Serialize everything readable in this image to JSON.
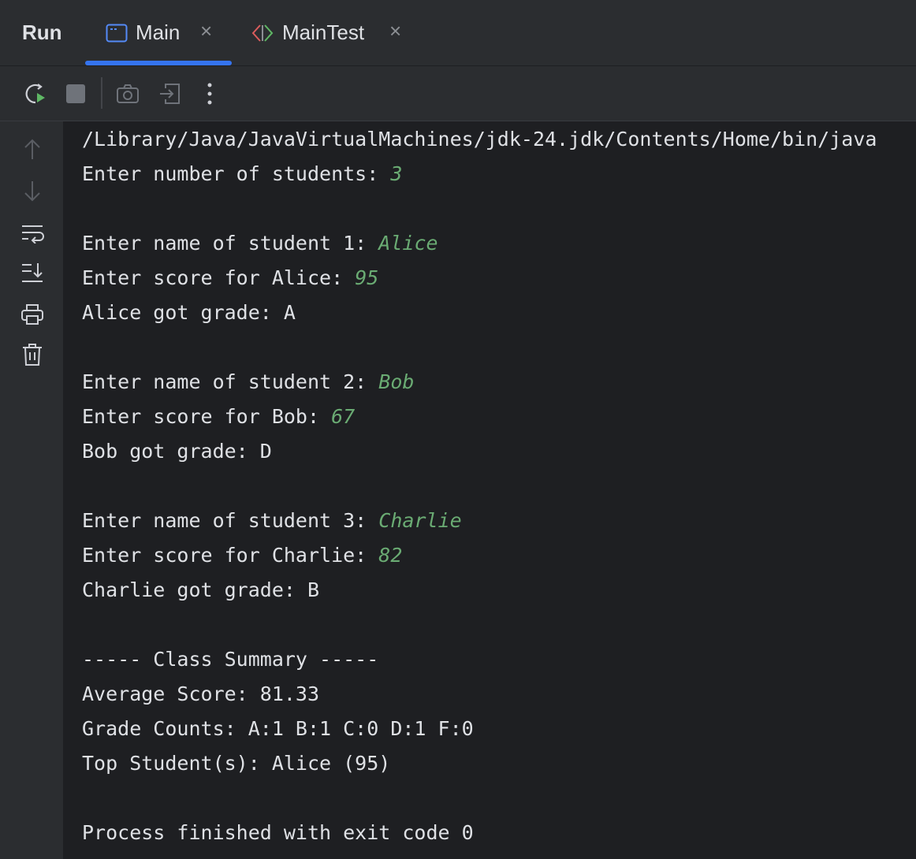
{
  "tabbar": {
    "run_label": "Run",
    "tabs": [
      {
        "label": "Main",
        "icon": "console-window-icon",
        "active": true
      },
      {
        "label": "MainTest",
        "icon": "test-diamond-icon",
        "active": false
      }
    ],
    "close_glyph": "×"
  },
  "colors": {
    "background": "#1e1f22",
    "panel": "#2b2d30",
    "text": "#dfe1e5",
    "user_input": "#6aab73",
    "accent": "#3574f0"
  },
  "toolbar": {
    "buttons": [
      "rerun-icon",
      "stop-icon",
      "screenshot-icon",
      "attach-icon",
      "more-icon"
    ]
  },
  "sidebar": {
    "buttons": [
      "arrow-up-icon",
      "arrow-down-icon",
      "soft-wrap-icon",
      "scroll-to-end-icon",
      "print-icon",
      "trash-icon"
    ]
  },
  "console": {
    "lines": [
      {
        "text": "/Library/Java/JavaVirtualMachines/jdk-24.jdk/Contents/Home/bin/java",
        "input": ""
      },
      {
        "text": "Enter number of students: ",
        "input": "3"
      },
      {
        "text": "",
        "input": ""
      },
      {
        "text": "Enter name of student 1: ",
        "input": "Alice"
      },
      {
        "text": "Enter score for Alice: ",
        "input": "95"
      },
      {
        "text": "Alice got grade: A",
        "input": ""
      },
      {
        "text": "",
        "input": ""
      },
      {
        "text": "Enter name of student 2: ",
        "input": "Bob"
      },
      {
        "text": "Enter score for Bob: ",
        "input": "67"
      },
      {
        "text": "Bob got grade: D",
        "input": ""
      },
      {
        "text": "",
        "input": ""
      },
      {
        "text": "Enter name of student 3: ",
        "input": "Charlie"
      },
      {
        "text": "Enter score for Charlie: ",
        "input": "82"
      },
      {
        "text": "Charlie got grade: B",
        "input": ""
      },
      {
        "text": "",
        "input": ""
      },
      {
        "text": "----- Class Summary -----",
        "input": ""
      },
      {
        "text": "Average Score: 81.33",
        "input": ""
      },
      {
        "text": "Grade Counts: A:1 B:1 C:0 D:1 F:0",
        "input": ""
      },
      {
        "text": "Top Student(s): Alice (95)",
        "input": ""
      },
      {
        "text": "",
        "input": ""
      },
      {
        "text": "Process finished with exit code 0",
        "input": ""
      }
    ]
  }
}
